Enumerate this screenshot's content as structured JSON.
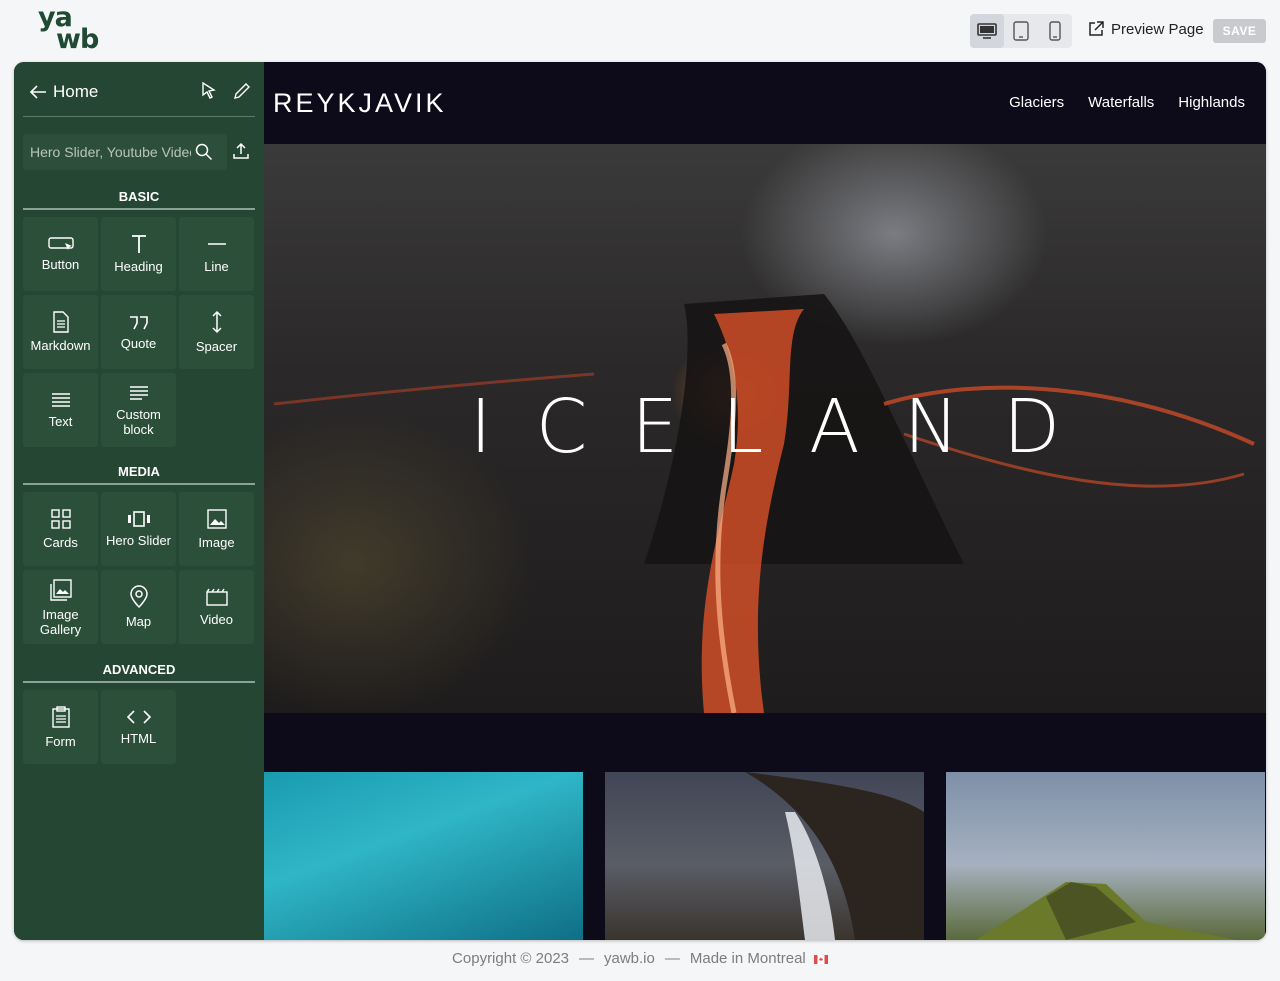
{
  "app": {
    "logo_top": "ya",
    "logo_bottom": "wb"
  },
  "toolbar": {
    "devices": [
      "desktop-icon",
      "tablet-icon",
      "mobile-icon"
    ],
    "preview_label": "Preview Page",
    "save_label": "SAVE"
  },
  "sidebar": {
    "home_label": "Home",
    "search_placeholder": "Hero Slider, Youtube Video...",
    "sections": {
      "basic": {
        "title": "BASIC",
        "items": [
          {
            "label": "Button",
            "icon": "button-icon"
          },
          {
            "label": "Heading",
            "icon": "heading-icon"
          },
          {
            "label": "Line",
            "icon": "line-icon"
          },
          {
            "label": "Markdown",
            "icon": "markdown-icon"
          },
          {
            "label": "Quote",
            "icon": "quote-icon"
          },
          {
            "label": "Spacer",
            "icon": "spacer-icon"
          },
          {
            "label": "Text",
            "icon": "text-icon"
          },
          {
            "label": "Custom block",
            "icon": "custom-block-icon"
          }
        ]
      },
      "media": {
        "title": "MEDIA",
        "items": [
          {
            "label": "Cards",
            "icon": "cards-icon"
          },
          {
            "label": "Hero Slider",
            "icon": "hero-slider-icon"
          },
          {
            "label": "Image",
            "icon": "image-icon"
          },
          {
            "label": "Image Gallery",
            "icon": "gallery-icon"
          },
          {
            "label": "Map",
            "icon": "map-pin-icon"
          },
          {
            "label": "Video",
            "icon": "video-icon"
          }
        ]
      },
      "advanced": {
        "title": "ADVANCED",
        "items": [
          {
            "label": "Form",
            "icon": "form-icon"
          },
          {
            "label": "HTML",
            "icon": "code-icon"
          }
        ]
      }
    }
  },
  "site": {
    "brand": "REYKJAVIK",
    "nav": [
      "Glaciers",
      "Waterfalls",
      "Highlands"
    ],
    "hero_title": "ICELAND"
  },
  "footer": {
    "copyright": "Copyright © 2023",
    "site": "yawb.io",
    "made_in": "Made in Montreal"
  },
  "colors": {
    "sidebar": "#254632",
    "tile": "#2c4f39",
    "site_bg": "#0d0b1a",
    "brand_green": "#1f4a33"
  }
}
